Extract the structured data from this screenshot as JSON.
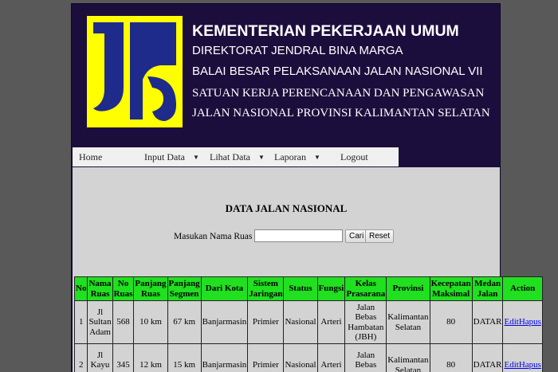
{
  "header": {
    "line1": "KEMENTERIAN PEKERJAAN UMUM",
    "line2": "DIREKTORAT JENDRAL BINA MARGA",
    "line3": "BALAI BESAR PELAKSANAAN JALAN NASIONAL VII",
    "line4": "SATUAN KERJA PERENCANAAN DAN PENGAWASAN",
    "line5": "JALAN NASIONAL PROVINSI KALIMANTAN SELATAN",
    "logo_colors": {
      "background": "#ffff00",
      "shape": "#1f2b8a"
    }
  },
  "nav": {
    "home": "Home",
    "input": "Input Data",
    "lihat": "Lihat Data",
    "laporan": "Laporan",
    "logout": "Logout",
    "caret": "▼"
  },
  "main": {
    "title": "DATA JALAN NASIONAL",
    "search_label": "Masukan Nama Ruas :",
    "search_value": "",
    "cari": "Cari",
    "reset": "Reset"
  },
  "table": {
    "headers": [
      "No",
      "Nama Ruas",
      "No Ruas",
      "Panjang Ruas",
      "Panjang Segmen",
      "Dari Kota",
      "Sistem Jaringan",
      "Status",
      "Fungsi",
      "Kelas Prasarana",
      "Provinsi",
      "Kecepatan Maksimal",
      "Medan Jalan",
      "Action"
    ],
    "rows": [
      {
        "no": "1",
        "nama": "Jl Sultan Adam",
        "no_ruas": "568",
        "panjang_ruas": "10 km",
        "panjang_segmen": "67 km",
        "dari_kota": "Banjarmasin",
        "sistem": "Primier",
        "status": "Nasional",
        "fungsi": "Arteri",
        "kelas": "Jalan Bebas Hambatan (JBH)",
        "provinsi": "Kalimantan Selatan",
        "kecepatan": "80",
        "medan": "DATAR",
        "edit": "Edit",
        "hapus": "Hapus"
      },
      {
        "no": "2",
        "nama": "Jl Kayu Tangi",
        "no_ruas": "345",
        "panjang_ruas": "12 km",
        "panjang_segmen": "15 km",
        "dari_kota": "Banjarmasin",
        "sistem": "Primier",
        "status": "Nasional",
        "fungsi": "Arteri",
        "kelas": "Jalan Bebas Hambatan",
        "provinsi": "Kalimantan Selatan",
        "kecepatan": "80",
        "medan": "DATAR",
        "edit": "Edit",
        "hapus": "Hapus"
      }
    ]
  },
  "colors": {
    "page_bg": "#595959",
    "header_bg": "#1c0e3c",
    "content_bg": "#d3d3d3",
    "table_header_bg": "#20e020",
    "link": "#0000ee"
  }
}
